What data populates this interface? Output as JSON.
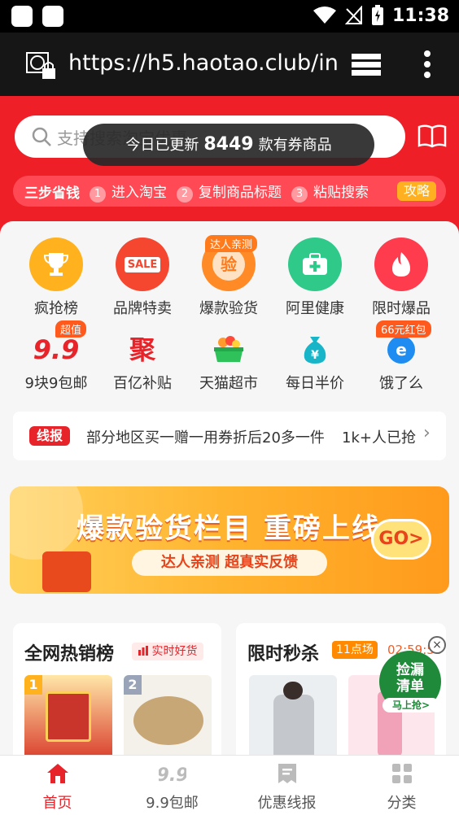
{
  "status_bar": {
    "time": "11:38"
  },
  "browser": {
    "url": "https://h5.haotao.club/in"
  },
  "search": {
    "placeholder": "支持搜索淘宝优惠"
  },
  "toast": {
    "prefix": "今日已更新",
    "count": "8449",
    "suffix": "款有券商品"
  },
  "steps": {
    "title": "三步省钱",
    "items": [
      {
        "num": "1",
        "label": "进入淘宝"
      },
      {
        "num": "2",
        "label": "复制商品标题"
      },
      {
        "num": "3",
        "label": "粘贴搜索"
      }
    ],
    "guide_label": "攻略"
  },
  "categories": [
    {
      "label": "疯抢榜",
      "icon": "trophy-icon",
      "color": "#ffb21e"
    },
    {
      "label": "品牌特卖",
      "icon": "sale-icon",
      "color": "#f5462f",
      "glyph": "SALE"
    },
    {
      "label": "爆款验货",
      "icon": "inspect-icon",
      "color": "#ff8a26",
      "glyph": "验",
      "badge": "达人亲测"
    },
    {
      "label": "阿里健康",
      "icon": "medkit-icon",
      "color": "#2fc98a",
      "glyph": "✚"
    },
    {
      "label": "限时爆品",
      "icon": "flame-icon",
      "color": "#ff3b4e",
      "glyph": "🔥"
    },
    {
      "label": "9块9包邮",
      "icon": "ninenine-icon",
      "glyph": "9.9",
      "badge": "超值"
    },
    {
      "label": "百亿补贴",
      "icon": "subsidy-icon",
      "glyph": "聚"
    },
    {
      "label": "天猫超市",
      "icon": "basket-icon",
      "glyph": "🧺"
    },
    {
      "label": "每日半价",
      "icon": "moneybag-icon",
      "glyph": "¥"
    },
    {
      "label": "饿了么",
      "icon": "eleme-icon",
      "glyph": "e",
      "badge": "66元红包"
    }
  ],
  "news": {
    "tag": "线报",
    "text": "部分地区买一赠一用券折后20多一件",
    "count": "1k+人已抢"
  },
  "banner": {
    "title": "爆款验货栏目 重磅上线",
    "subtitle": "达人亲测 超真实反馈",
    "go": "GO>"
  },
  "hot_card": {
    "title": "全网热销榜",
    "tag": "实时好货",
    "ranks": [
      "1",
      "2"
    ]
  },
  "flash_card": {
    "title": "限时秒杀",
    "session": "11点场",
    "countdown": "02:59:56"
  },
  "float_widget": {
    "line1": "捡漏",
    "line2": "清单",
    "button": "马上抢>",
    "close": "×"
  },
  "tabs": [
    {
      "label": "首页",
      "icon": "home-icon"
    },
    {
      "label": "9.9包邮",
      "icon": "ninenine-tab-icon"
    },
    {
      "label": "优惠线报",
      "icon": "doc-icon"
    },
    {
      "label": "分类",
      "icon": "grid-icon"
    }
  ]
}
